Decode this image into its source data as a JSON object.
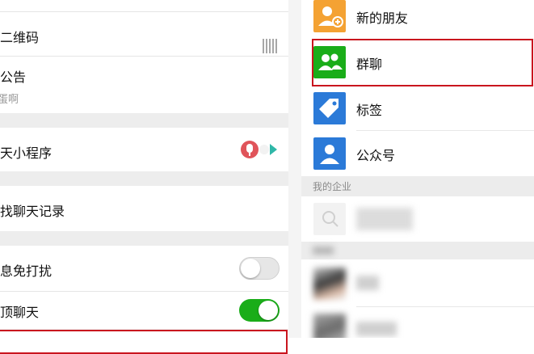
{
  "group_settings": {
    "qr_code_label": "群二维码",
    "announcement_label": "群公告",
    "announcement_preview": "蒙蛋啊",
    "mini_program_label": "聊天小程序",
    "search_history_label": "查找聊天记录",
    "mute_label": "消息免打扰",
    "mute_enabled": false,
    "pin_label": "置顶聊天",
    "pin_enabled": true
  },
  "contacts": {
    "items": [
      {
        "label": "新的朋友",
        "icon": "add-friend-icon",
        "color": "#f4a233"
      },
      {
        "label": "群聊",
        "icon": "group-chat-icon",
        "color": "#1aad19"
      },
      {
        "label": "标签",
        "icon": "tag-icon",
        "color": "#2b7ad8"
      },
      {
        "label": "公众号",
        "icon": "official-account-icon",
        "color": "#2b7ad8"
      }
    ],
    "enterprise_header": "我的企业"
  },
  "colors": {
    "highlight_border": "#c9151e",
    "toggle_on": "#1aad19"
  }
}
